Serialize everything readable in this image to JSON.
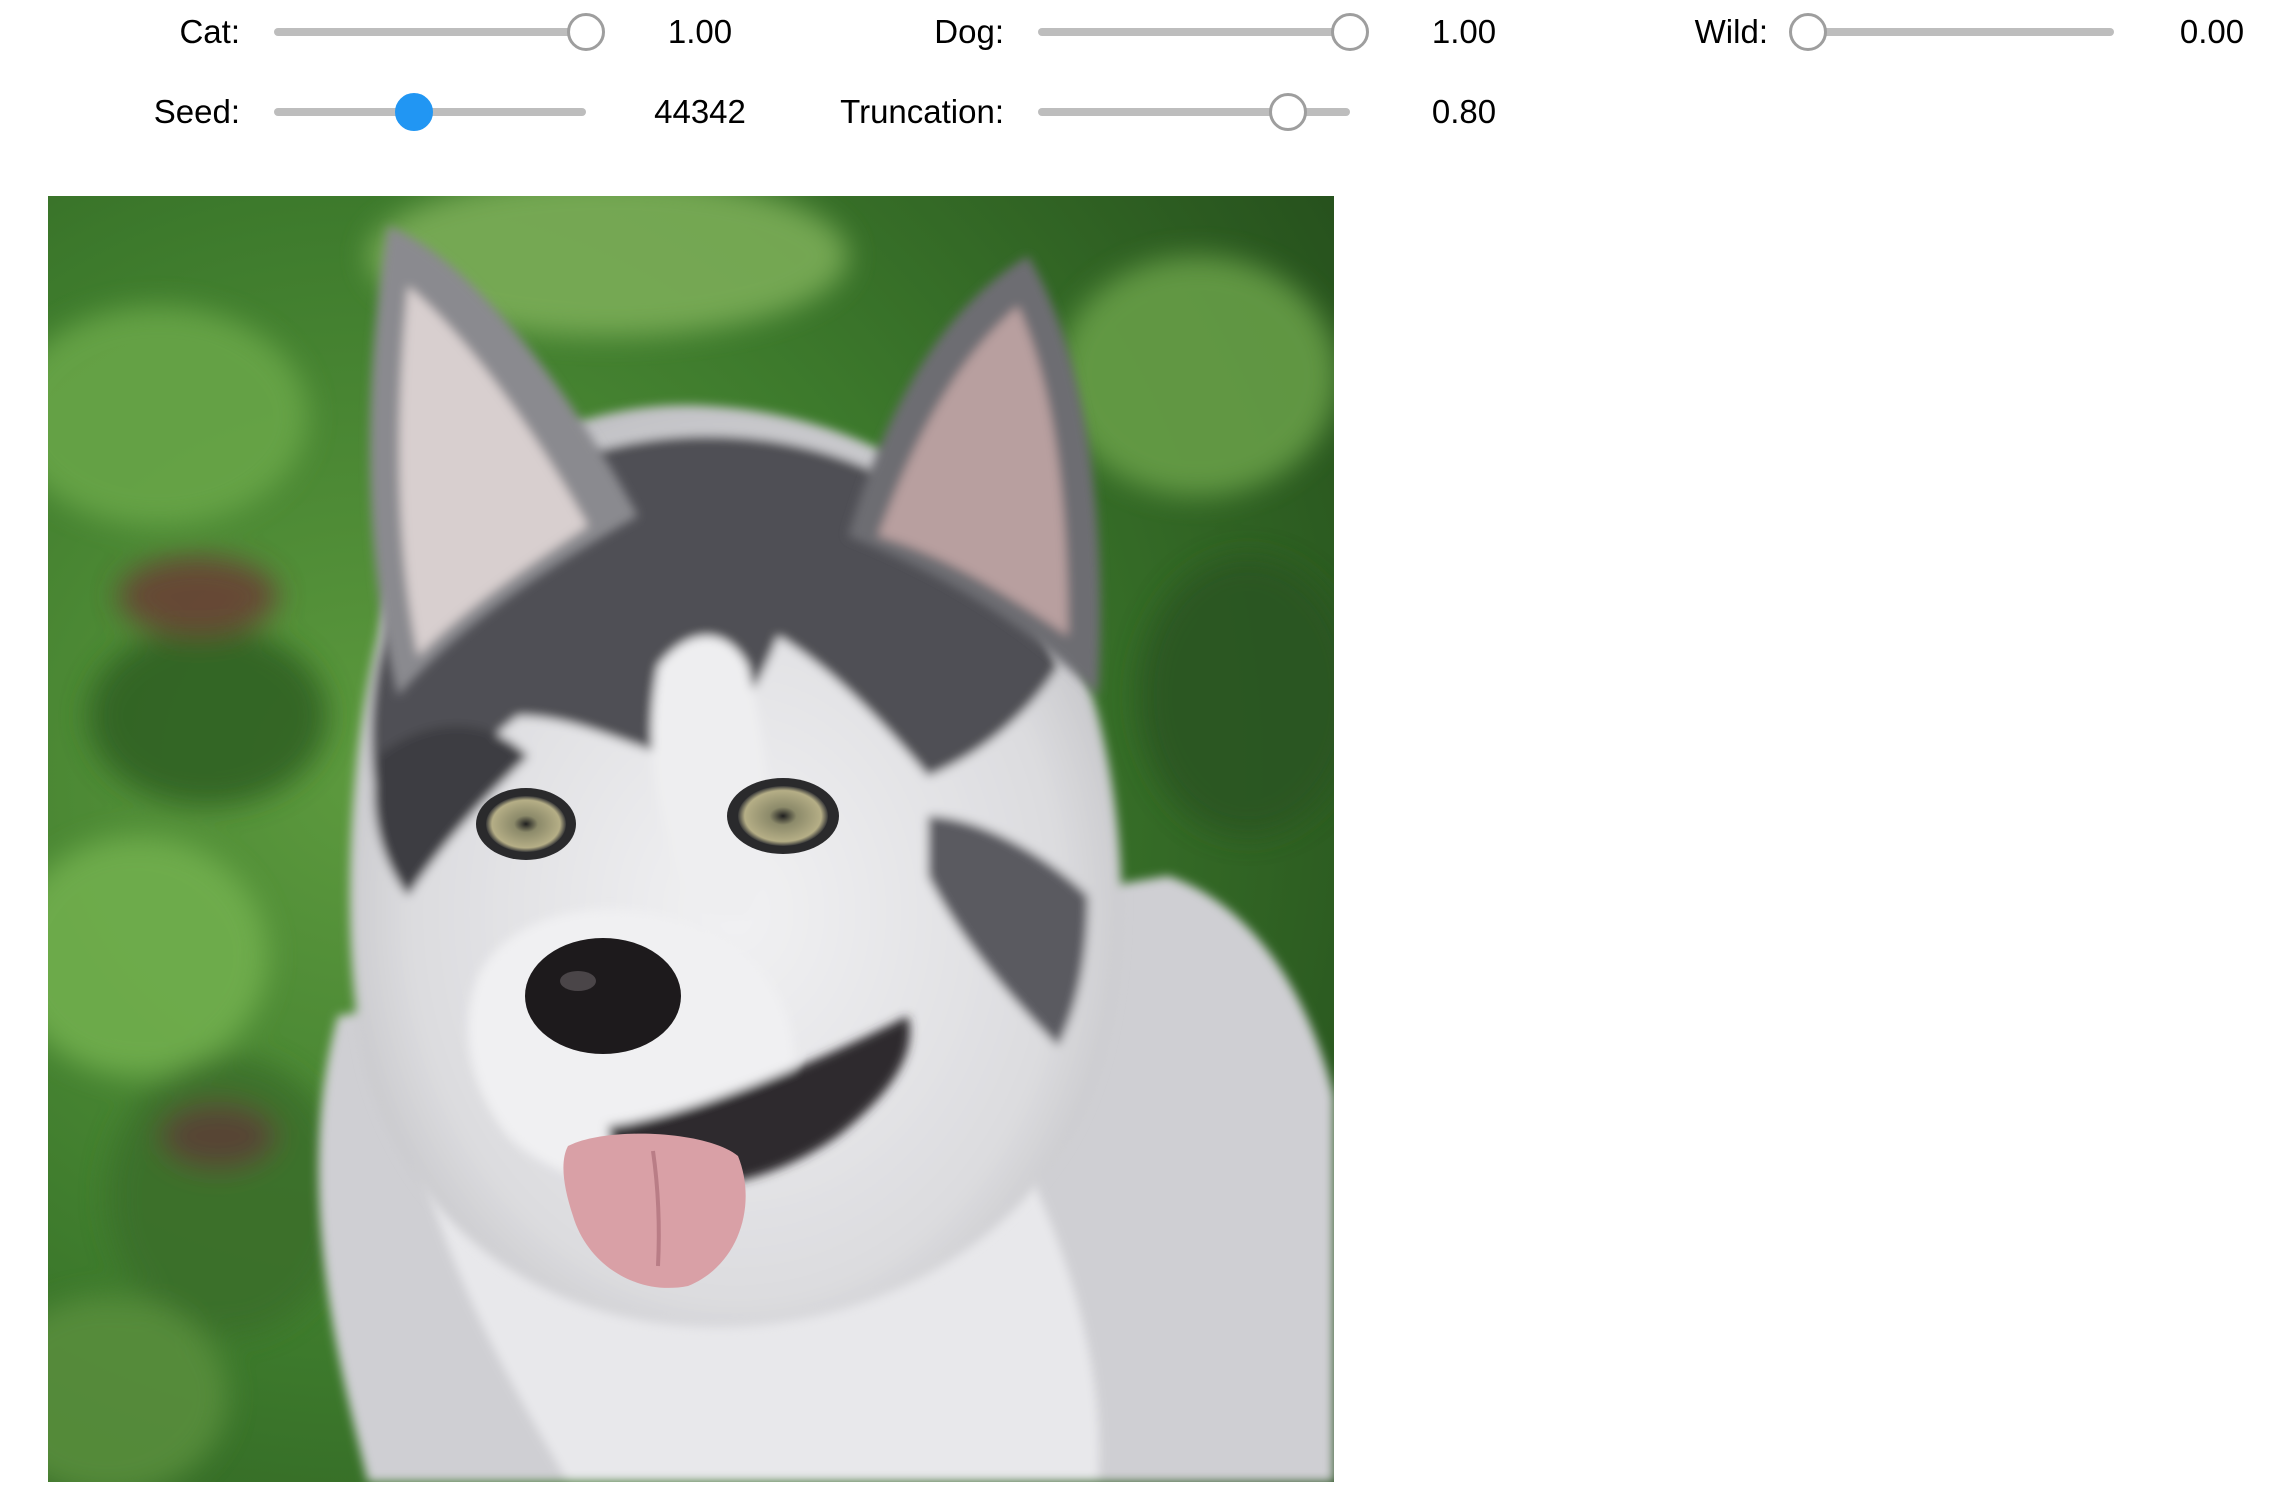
{
  "sliders": {
    "cat": {
      "label": "Cat:",
      "value_text": "1.00",
      "value": 1.0,
      "min": 0,
      "max": 1
    },
    "dog": {
      "label": "Dog:",
      "value_text": "1.00",
      "value": 1.0,
      "min": 0,
      "max": 1
    },
    "wild": {
      "label": "Wild:",
      "value_text": "0.00",
      "value": 0.0,
      "min": 0,
      "max": 1
    },
    "seed": {
      "label": "Seed:",
      "value_text": "44342",
      "value": 0.45,
      "active": true
    },
    "truncation": {
      "label": "Truncation:",
      "value_text": "0.80",
      "value": 0.8,
      "min": 0,
      "max": 1
    }
  },
  "output_image": {
    "subject": "husky-dog-portrait",
    "colors": {
      "background_green": "#3f7a2e",
      "fur_dark": "#4a4a4e",
      "fur_light": "#e9e9ec",
      "tongue": "#d9a0a6",
      "nose": "#1d1a1c"
    }
  },
  "colors": {
    "slider_track": "#bdbdbd",
    "slider_handle_border": "#9e9e9e",
    "slider_active": "#2196f3"
  }
}
